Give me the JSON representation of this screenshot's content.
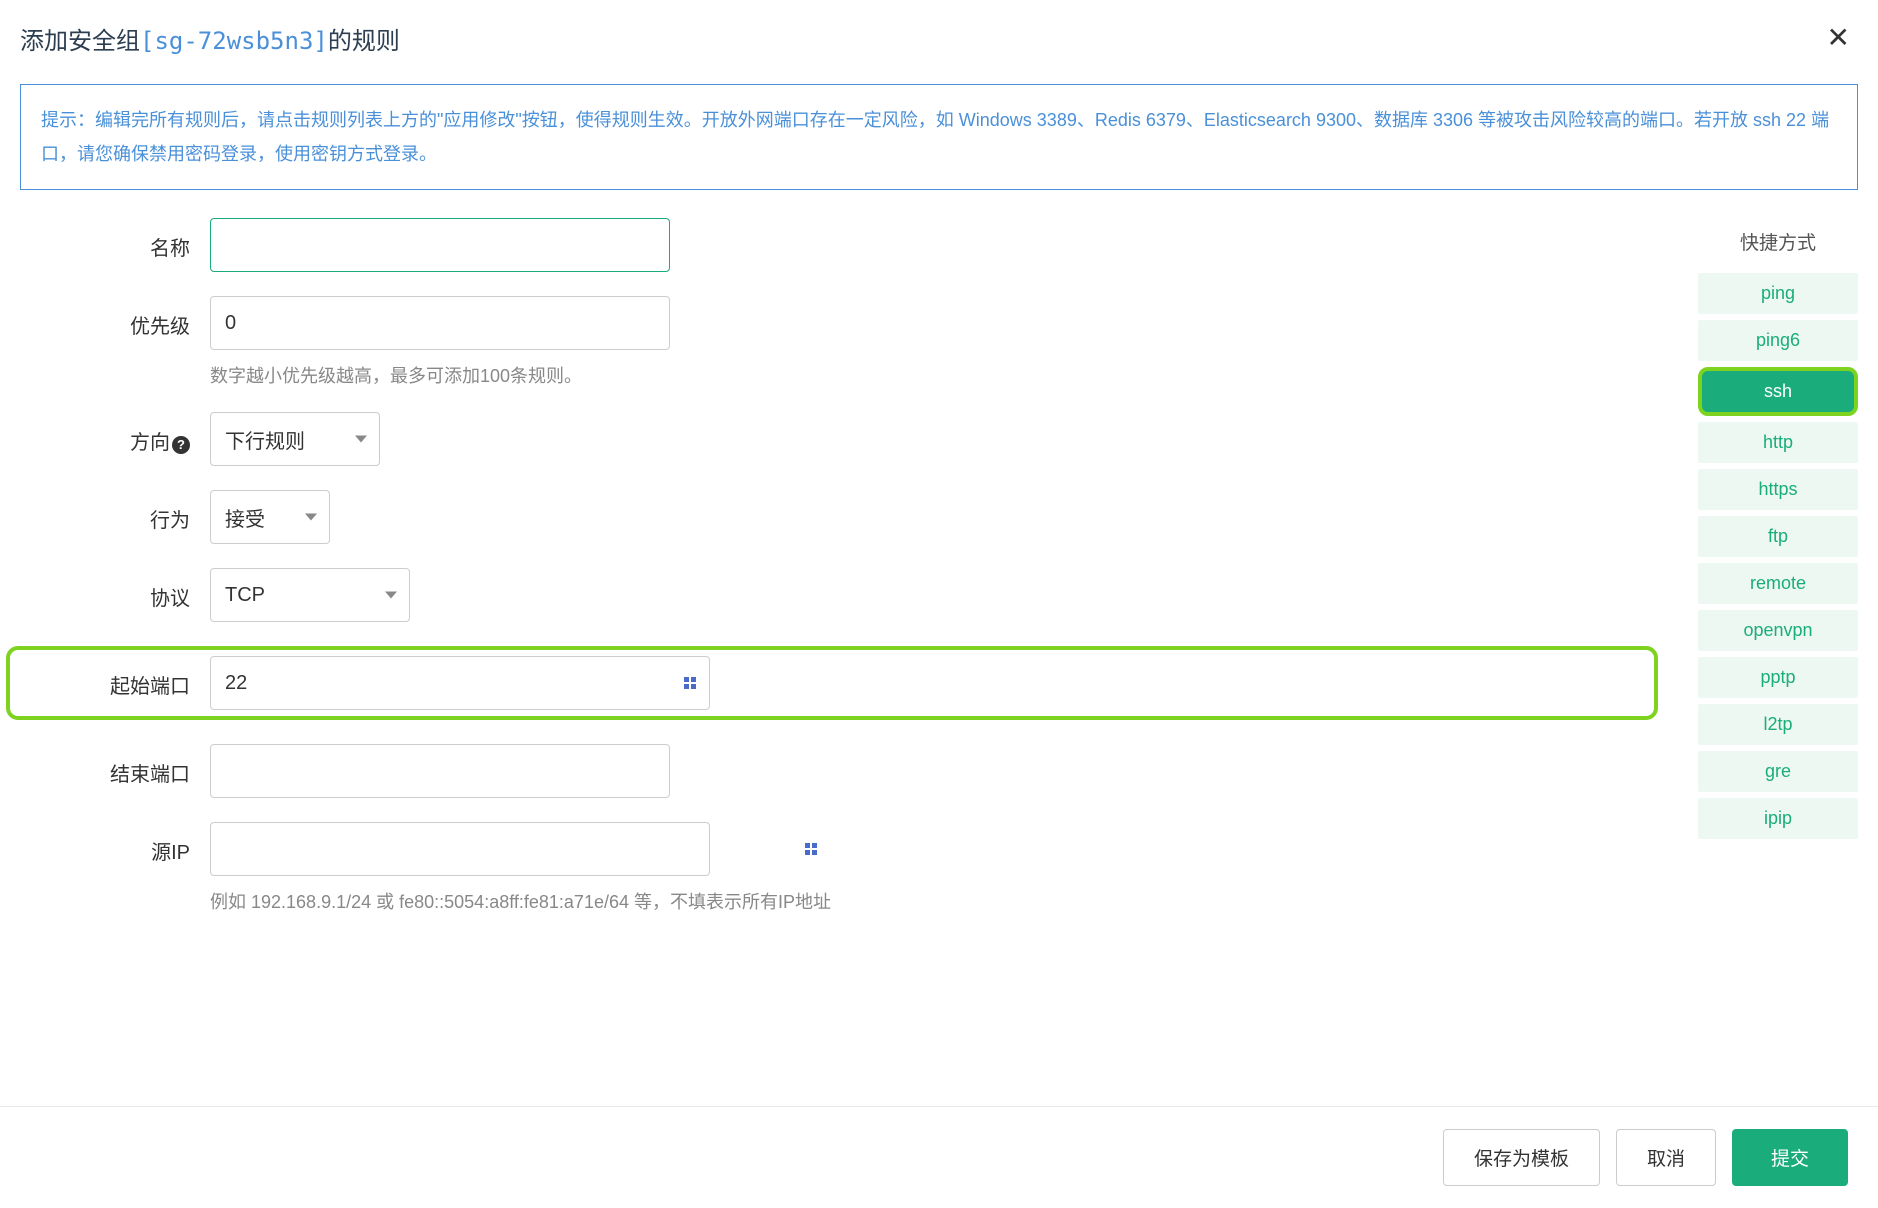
{
  "header": {
    "title_prefix": "添加安全组",
    "sg_id": "[sg-72wsb5n3]",
    "title_suffix": "的规则"
  },
  "alert": "提示：编辑完所有规则后，请点击规则列表上方的\"应用修改\"按钮，使得规则生效。开放外网端口存在一定风险，如 Windows 3389、Redis 6379、Elasticsearch 9300、数据库 3306 等被攻击风险较高的端口。若开放 ssh 22 端口，请您确保禁用密码登录，使用密钥方式登录。",
  "form": {
    "name": {
      "label": "名称",
      "value": ""
    },
    "priority": {
      "label": "优先级",
      "value": "0",
      "hint": "数字越小优先级越高，最多可添加100条规则。"
    },
    "direction": {
      "label": "方向",
      "value": "下行规则"
    },
    "action": {
      "label": "行为",
      "value": "接受"
    },
    "protocol": {
      "label": "协议",
      "value": "TCP"
    },
    "start_port": {
      "label": "起始端口",
      "value": "22"
    },
    "end_port": {
      "label": "结束端口",
      "value": ""
    },
    "source_ip": {
      "label": "源IP",
      "value": "",
      "hint": "例如 192.168.9.1/24 或 fe80::5054:a8ff:fe81:a71e/64 等，不填表示所有IP地址"
    }
  },
  "shortcuts": {
    "title": "快捷方式",
    "items": [
      "ping",
      "ping6",
      "ssh",
      "http",
      "https",
      "ftp",
      "remote",
      "openvpn",
      "pptp",
      "l2tp",
      "gre",
      "ipip"
    ],
    "selected": "ssh"
  },
  "footer": {
    "save_template": "保存为模板",
    "cancel": "取消",
    "submit": "提交"
  }
}
